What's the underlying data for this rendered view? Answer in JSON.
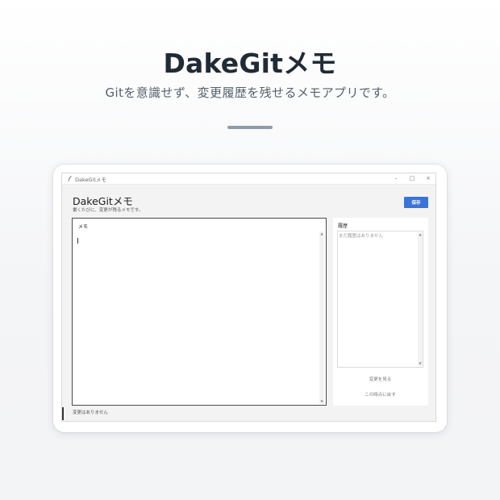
{
  "hero": {
    "title": "DakeGitメモ",
    "subtitle": "Gitを意識せず、変更履歴を残せるメモアプリです。"
  },
  "window": {
    "title": "DakeGitメモ",
    "controls": {
      "minimize": "–",
      "maximize": "□",
      "close": "×"
    }
  },
  "app": {
    "title": "DakeGitメモ",
    "subtitle": "書くたびに、変更が残るメモです。",
    "save_label": "保存"
  },
  "memo": {
    "label": "メモ",
    "value": ""
  },
  "history": {
    "label": "履歴",
    "empty_text": "まだ履歴はありません",
    "view_changes_label": "変更を見る",
    "revert_label": "この時点に戻す"
  },
  "status": {
    "text": "変更はありません"
  },
  "icons": {
    "app": "feather-icon",
    "scroll_up": "chevron-up-icon",
    "scroll_down": "chevron-down-icon"
  },
  "colors": {
    "accent": "#3b74d9",
    "hero_title": "#202b36",
    "hero_subtitle": "#56606b",
    "divider": "#8f9ba8"
  }
}
